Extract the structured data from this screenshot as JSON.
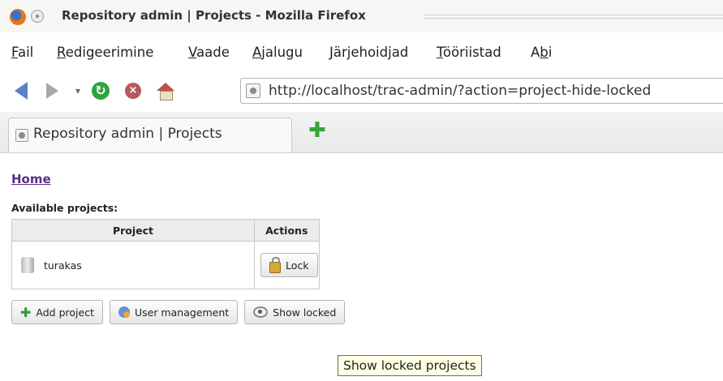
{
  "window": {
    "title": "Repository admin | Projects - Mozilla Firefox"
  },
  "menubar": {
    "items": [
      {
        "underline": "F",
        "rest": "ail"
      },
      {
        "underline": "R",
        "rest": "edigeerimine"
      },
      {
        "underline": "V",
        "rest": "aade"
      },
      {
        "underline": "A",
        "rest": "jalugu"
      },
      {
        "underline": "J",
        "rest": "ärjehoidjad"
      },
      {
        "underline": "T",
        "rest": "ööriistad"
      },
      {
        "prefix": "A",
        "underline": "b",
        "rest": "i"
      }
    ]
  },
  "navbar": {
    "url": "http://localhost/trac-admin/?action=project-hide-locked"
  },
  "tabs": {
    "active_label": "Repository admin | Projects",
    "new_tab_icon": "plus-icon"
  },
  "page": {
    "home_link": "Home",
    "available_heading": "Available projects:",
    "table": {
      "headers": [
        "Project",
        "Actions"
      ],
      "rows": [
        {
          "name": "turakas",
          "action": "Lock"
        }
      ]
    },
    "buttons": {
      "add_project": "Add project",
      "user_management": "User management",
      "show_locked": "Show locked"
    },
    "tooltip": "Show locked projects"
  }
}
